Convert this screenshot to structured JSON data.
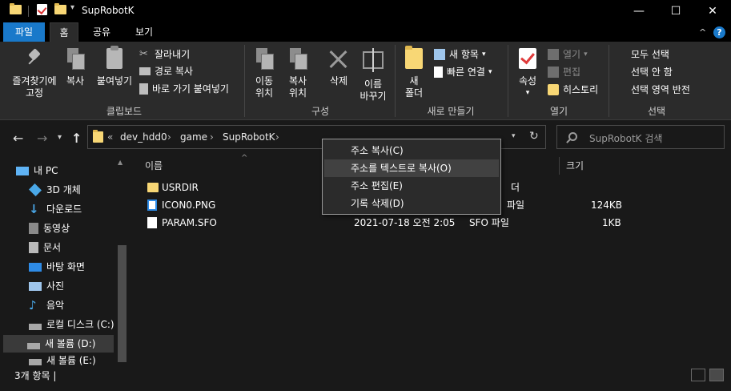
{
  "window": {
    "title": "SupRobotK",
    "minimize": "—",
    "maximize": "☐",
    "close": "✕"
  },
  "tabs": [
    {
      "label": "파일"
    },
    {
      "label": "홈"
    },
    {
      "label": "공유"
    },
    {
      "label": "보기"
    }
  ],
  "ribbon": {
    "clipboard": {
      "pin": "즐겨찾기에\n고정",
      "copy": "복사",
      "paste": "붙여넣기",
      "cut": "잘라내기",
      "copy_path": "경로 복사",
      "paste_shortcut": "바로 가기 붙여넣기",
      "label": "클립보드"
    },
    "organize": {
      "move_to": "이동\n위치",
      "copy_to": "복사\n위치",
      "delete": "삭제",
      "rename": "이름\n바꾸기",
      "label": "구성"
    },
    "new": {
      "new_folder": "새\n폴더",
      "new_item": "새 항목",
      "easy_access": "빠른 연결",
      "label": "새로 만들기"
    },
    "open": {
      "properties": "속성",
      "open": "열기",
      "edit": "편집",
      "history": "히스토리",
      "label": "열기"
    },
    "select": {
      "select_all": "모두 선택",
      "select_none": "선택 안 함",
      "invert": "선택 영역 반전",
      "label": "선택"
    }
  },
  "address": {
    "chevrons": "«",
    "crumbs": [
      "dev_hdd0",
      "game",
      "SupRobotK"
    ],
    "sep": "›"
  },
  "search": {
    "placeholder": "SupRobotK 검색"
  },
  "nav_pane": [
    {
      "label": "내 PC",
      "icon": "pc-icon"
    },
    {
      "label": "3D 개체",
      "icon": "3d-objects-icon"
    },
    {
      "label": "다운로드",
      "icon": "download-icon"
    },
    {
      "label": "동영상",
      "icon": "video-icon"
    },
    {
      "label": "문서",
      "icon": "documents-icon"
    },
    {
      "label": "바탕 화면",
      "icon": "desktop-icon"
    },
    {
      "label": "사진",
      "icon": "pictures-icon"
    },
    {
      "label": "음악",
      "icon": "music-icon"
    },
    {
      "label": "로컬 디스크 (C:)",
      "icon": "drive-icon"
    },
    {
      "label": "새 볼륨 (D:)",
      "icon": "drive-icon"
    },
    {
      "label": "새 볼륨 (E:)",
      "icon": "drive-icon"
    }
  ],
  "columns": {
    "name": "이름",
    "size": "크기"
  },
  "files": [
    {
      "name": "USRDIR",
      "date": "",
      "type": "더",
      "size": ""
    },
    {
      "name": "ICON0.PNG",
      "date": "",
      "type": "파일",
      "size": "124KB"
    },
    {
      "name": "PARAM.SFO",
      "date": "2021-07-18 오전 2:05",
      "type": "SFO 파일",
      "size": "1KB"
    }
  ],
  "context_menu": [
    {
      "label": "주소 복사(C)"
    },
    {
      "label": "주소를 텍스트로 복사(O)"
    },
    {
      "label": "주소 편집(E)"
    },
    {
      "label": "기록 삭제(D)"
    }
  ],
  "status": {
    "text": "3개 항목  |"
  },
  "colors": {
    "accent": "#1979ca",
    "background": "#191919",
    "ribbon": "#2b2b2b",
    "folder": "#f8d775"
  }
}
